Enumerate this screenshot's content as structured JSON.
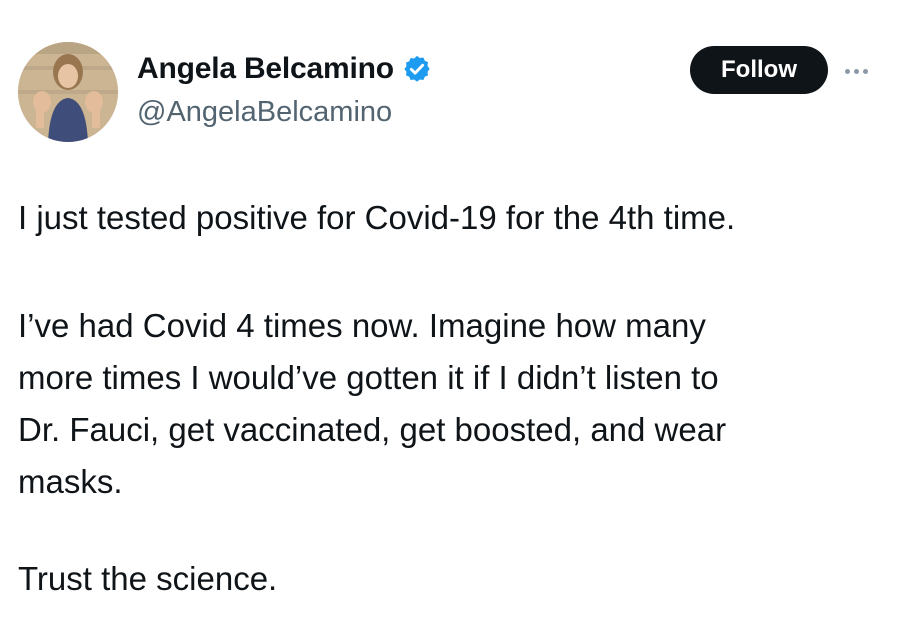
{
  "author": {
    "display_name": "Angela Belcamino",
    "handle": "@AngelaBelcamino",
    "verified_icon": "verified-badge-icon",
    "verified_color": "#1d9bf0"
  },
  "actions": {
    "follow_label": "Follow",
    "more_icon": "more-options-icon"
  },
  "tweet": {
    "paragraph_1": "I just tested positive for Covid-19 for the 4th time.",
    "paragraph_2_lines": [
      "I’ve had Covid 4 times now. Imagine how many",
      "more times I would’ve gotten it if I didn’t listen to",
      "Dr. Fauci, get vaccinated, get boosted, and wear",
      "masks."
    ],
    "paragraph_3": "Trust the science."
  },
  "colors": {
    "text": "#0f1419",
    "secondary_text": "#536471",
    "button_bg": "#0f1419",
    "button_text": "#ffffff"
  }
}
